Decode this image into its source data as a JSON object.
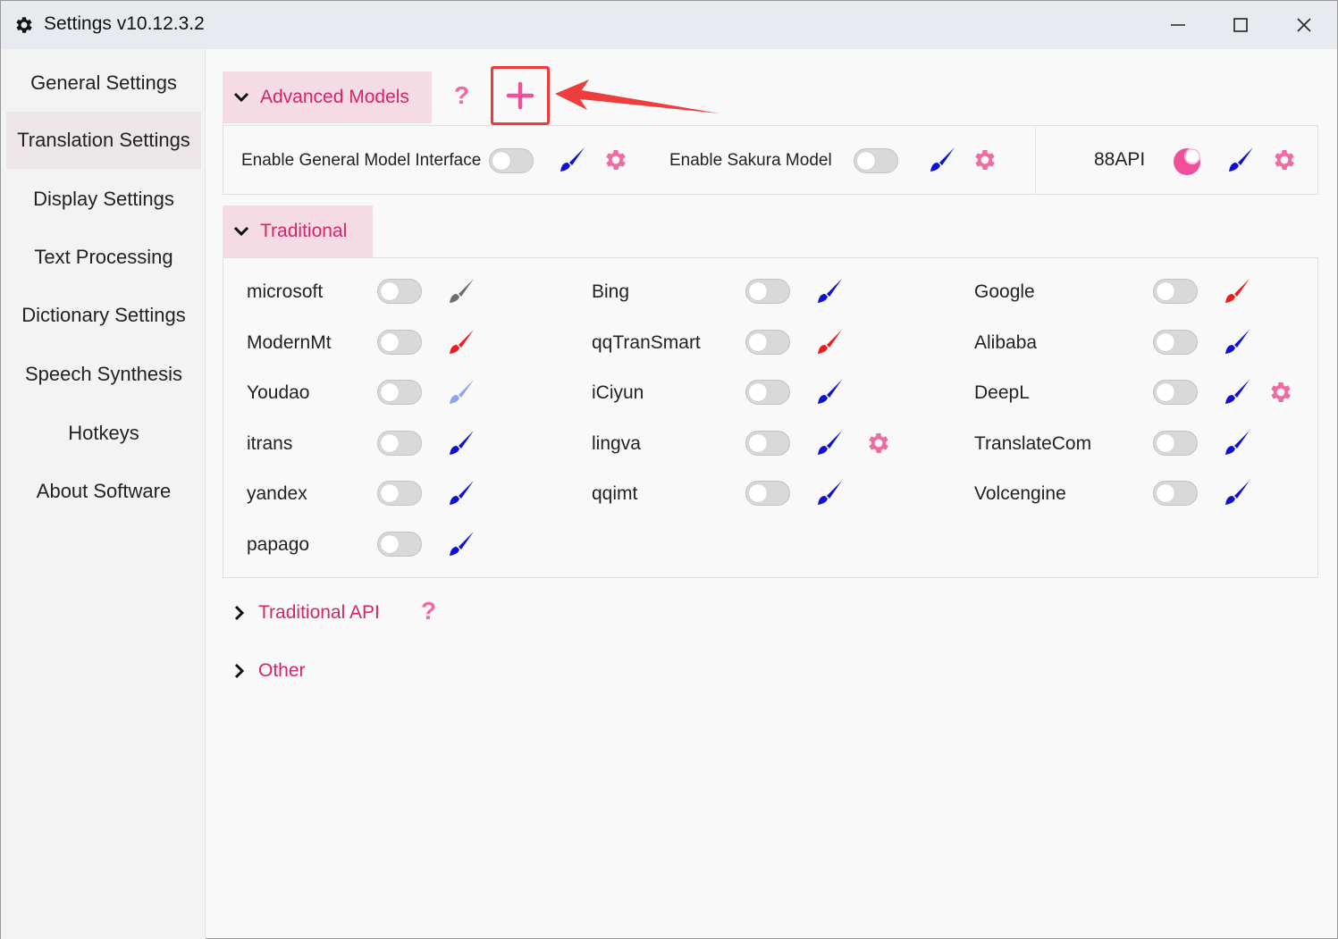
{
  "window": {
    "title": "Settings v10.12.3.2"
  },
  "sidebar": {
    "items": [
      {
        "label": "General Settings",
        "active": false
      },
      {
        "label": "Translation Settings",
        "active": true
      },
      {
        "label": "Display Settings",
        "active": false
      },
      {
        "label": "Text Processing",
        "active": false
      },
      {
        "label": "Dictionary Settings",
        "active": false
      },
      {
        "label": "Speech Synthesis",
        "active": false
      },
      {
        "label": "Hotkeys",
        "active": false
      },
      {
        "label": "About Software",
        "active": false
      }
    ]
  },
  "advanced": {
    "title": "Advanced Models",
    "help": "?",
    "items": [
      {
        "label": "Enable General Model Interface",
        "enabled": false,
        "brush_color": "#1010d0",
        "has_gear": true
      },
      {
        "label": "Enable Sakura Model",
        "enabled": false,
        "brush_color": "#1010d0",
        "has_gear": true
      },
      {
        "label": "88API",
        "enabled": true,
        "brush_color": "#1010d0",
        "has_gear": true
      }
    ]
  },
  "traditional": {
    "title": "Traditional",
    "items": [
      {
        "label": "microsoft",
        "enabled": false,
        "brush_color": "#6e6e6e",
        "has_gear": false
      },
      {
        "label": "Bing",
        "enabled": false,
        "brush_color": "#1010d0",
        "has_gear": false
      },
      {
        "label": "Google",
        "enabled": false,
        "brush_color": "#ee1c1c",
        "has_gear": false
      },
      {
        "label": "ModernMt",
        "enabled": false,
        "brush_color": "#ee1c1c",
        "has_gear": false
      },
      {
        "label": "qqTranSmart",
        "enabled": false,
        "brush_color": "#ee1c1c",
        "has_gear": false
      },
      {
        "label": "Alibaba",
        "enabled": false,
        "brush_color": "#1010d0",
        "has_gear": false
      },
      {
        "label": "Youdao",
        "enabled": false,
        "brush_color": "#8fa3ee",
        "has_gear": false
      },
      {
        "label": "iCiyun",
        "enabled": false,
        "brush_color": "#1010d0",
        "has_gear": false
      },
      {
        "label": "DeepL",
        "enabled": false,
        "brush_color": "#1010d0",
        "has_gear": true
      },
      {
        "label": "itrans",
        "enabled": false,
        "brush_color": "#1010d0",
        "has_gear": false
      },
      {
        "label": "lingva",
        "enabled": false,
        "brush_color": "#1010d0",
        "has_gear": true
      },
      {
        "label": "TranslateCom",
        "enabled": false,
        "brush_color": "#1010d0",
        "has_gear": false
      },
      {
        "label": "yandex",
        "enabled": false,
        "brush_color": "#1010d0",
        "has_gear": false
      },
      {
        "label": "qqimt",
        "enabled": false,
        "brush_color": "#1010d0",
        "has_gear": false
      },
      {
        "label": "Volcengine",
        "enabled": false,
        "brush_color": "#1010d0",
        "has_gear": false
      },
      {
        "label": "papago",
        "enabled": false,
        "brush_color": "#1010d0",
        "has_gear": false
      }
    ]
  },
  "traditional_api": {
    "title": "Traditional API",
    "help": "?"
  },
  "other": {
    "title": "Other"
  },
  "colors": {
    "accent": "#d6246b",
    "accent_light": "#f06aa3",
    "highlight_box": "#f03a3a"
  },
  "icons": [
    "gear-icon",
    "minimize-icon",
    "maximize-icon",
    "close-icon",
    "chevron-down-icon",
    "chevron-right-icon",
    "help-icon",
    "plus-icon",
    "arrow-icon",
    "brush-icon"
  ]
}
